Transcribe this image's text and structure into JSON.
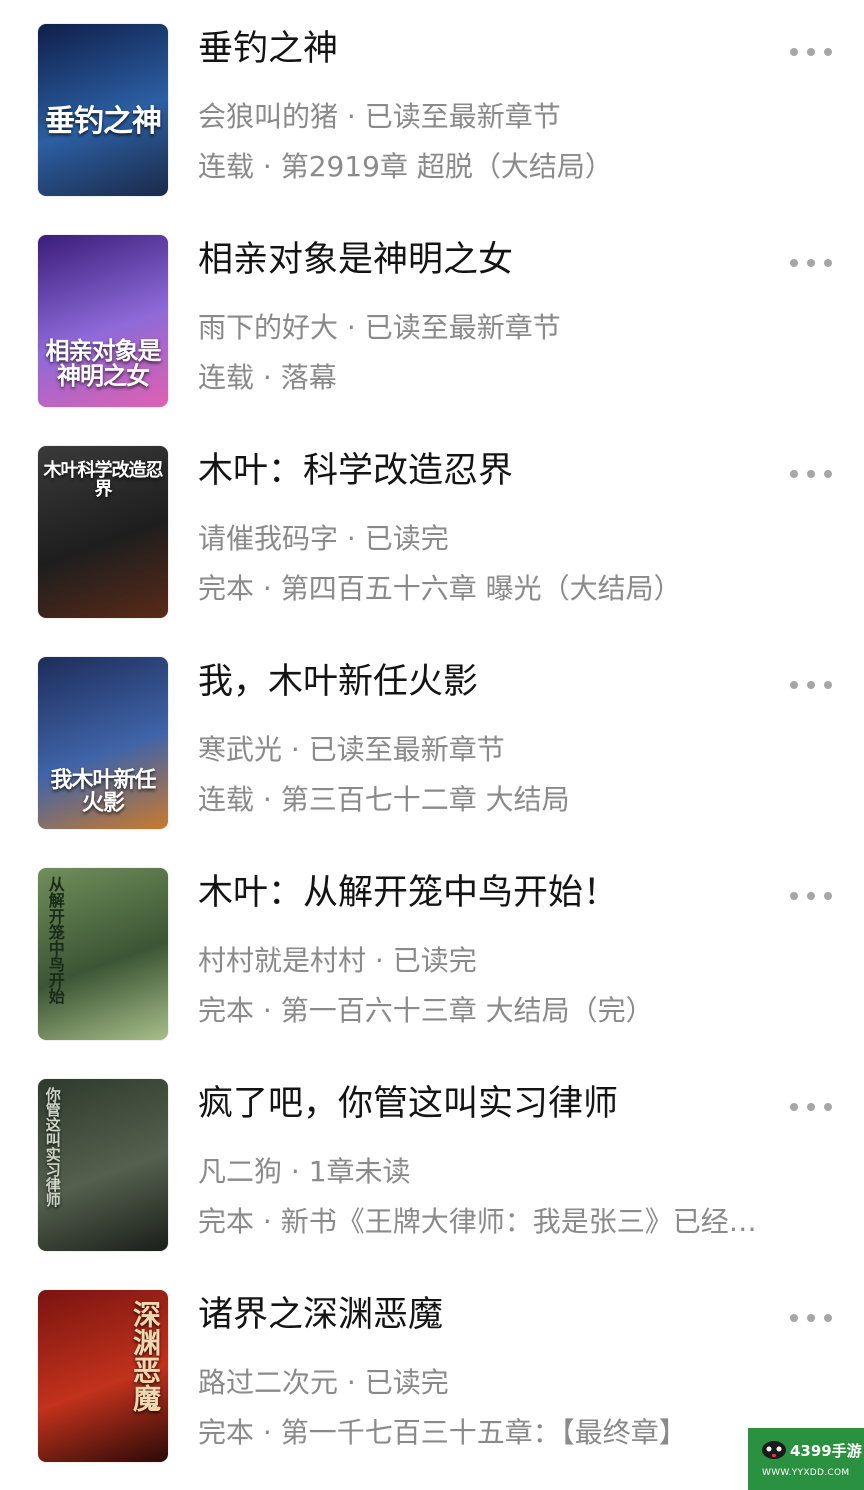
{
  "books": [
    {
      "title": "垂钓之神",
      "author_line": "会狼叫的猪 · 已读至最新章节",
      "status_line": "连载 · 第2919章 超脱（大结局）",
      "cover_title": "垂钓之神",
      "cover_colors": [
        "#0f1f4a",
        "#2c5fa3",
        "#1b2a48"
      ]
    },
    {
      "title": "相亲对象是神明之女",
      "author_line": "雨下的好大 · 已读至最新章节",
      "status_line": "连载 · 落幕",
      "cover_title": "相亲对象是神明之女",
      "cover_colors": [
        "#3a1d7a",
        "#8e6ad8",
        "#e060b0"
      ]
    },
    {
      "title": "木叶：科学改造忍界",
      "author_line": "请催我码字 · 已读完",
      "status_line": "完本 · 第四百五十六章 曝光（大结局）",
      "cover_title": "木叶科学改造忍界",
      "cover_colors": [
        "#3a3a3a",
        "#1e1e1e",
        "#5a2a18"
      ]
    },
    {
      "title": "我，木叶新任火影",
      "author_line": "寒武光 · 已读至最新章节",
      "status_line": "连载 · 第三百七十二章 大结局",
      "cover_title": "我木叶新任火影",
      "cover_colors": [
        "#1e2d5a",
        "#3f64a8",
        "#c97a2e"
      ]
    },
    {
      "title": "木叶：从解开笼中鸟开始！",
      "author_line": "村村就是村村 · 已读完",
      "status_line": "完本 · 第一百六十三章 大结局（完）",
      "cover_title": "从解开笼中鸟开始",
      "cover_colors": [
        "#6f8f5a",
        "#3c5534",
        "#a8bf8a"
      ]
    },
    {
      "title": "疯了吧，你管这叫实习律师",
      "author_line": "凡二狗 · 1章未读",
      "status_line": "完本 · 新书《王牌大律师：我是张三》已经…",
      "cover_title": "你管这叫实习律师",
      "cover_colors": [
        "#2e3a2c",
        "#55604e",
        "#1a1f1a"
      ]
    },
    {
      "title": "诸界之深渊恶魔",
      "author_line": "路过二次元 · 已读完",
      "status_line": "完本 · 第一千七百三十五章：【最终章】",
      "cover_title": "深渊恶魔",
      "cover_colors": [
        "#7a1410",
        "#c2321c",
        "#2a0a08"
      ]
    }
  ],
  "more_icon": "more-horizontal-icon",
  "watermark": {
    "title": "4399手游",
    "url": "WWW.YYXDD.COM",
    "color": "#2a9140"
  }
}
